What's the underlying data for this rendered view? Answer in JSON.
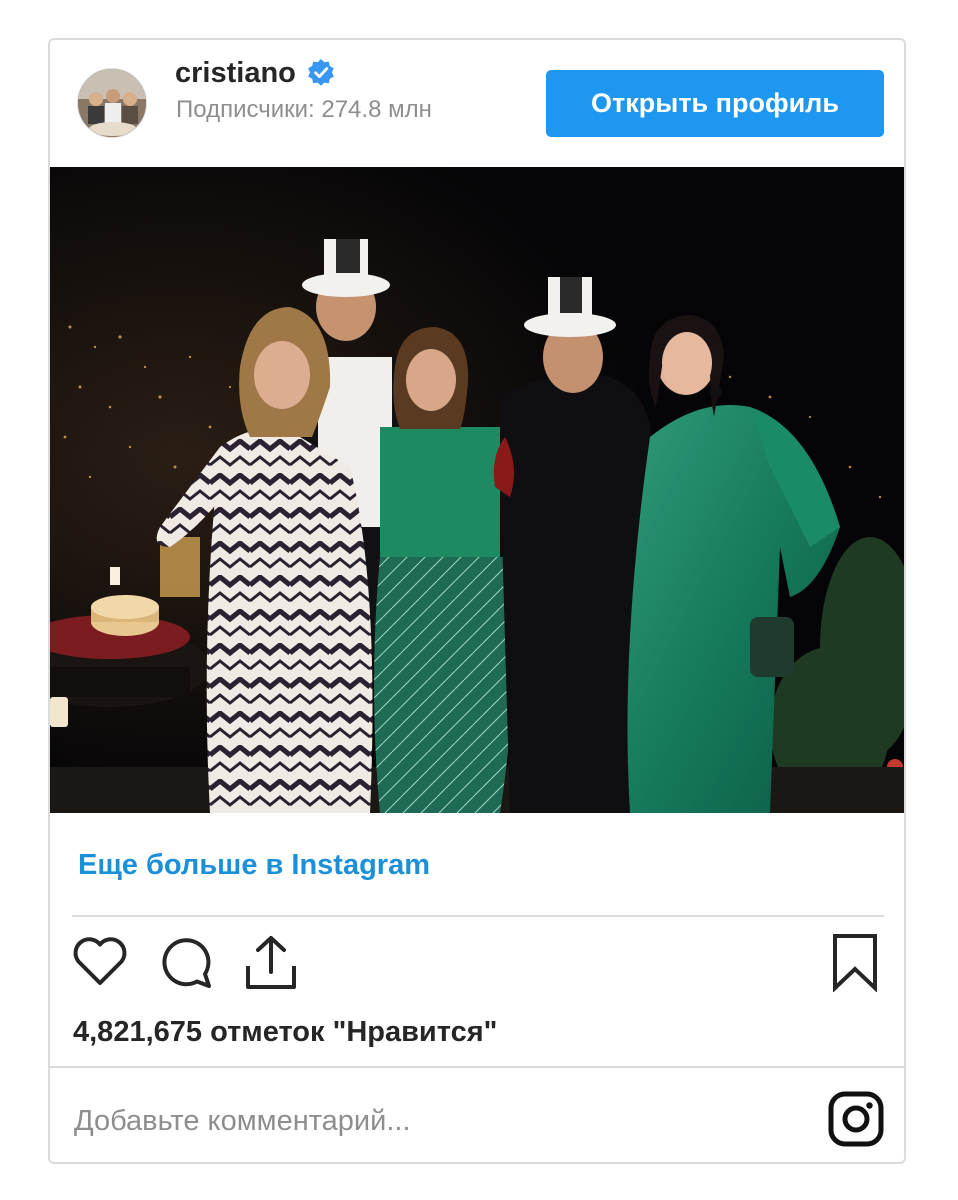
{
  "header": {
    "username": "cristiano",
    "verified_icon": "verified-badge-icon",
    "followers": "Подписчики: 274.8 млн",
    "open_profile_label": "Открыть профиль"
  },
  "post": {
    "image_label": "",
    "more_link": "Еще больше в Instagram",
    "likes": "4,821,675 отметок \"Нравится\"",
    "comment_placeholder": "Добавьте комментарий..."
  },
  "icons": {
    "like": "heart-icon",
    "comment": "comment-icon",
    "share": "share-icon",
    "save": "bookmark-icon",
    "brand": "instagram-logo-icon"
  },
  "colors": {
    "accent": "#1e97f0",
    "link": "#1b8fd8",
    "muted": "#8e8e8e",
    "verified": "#3897f0"
  }
}
